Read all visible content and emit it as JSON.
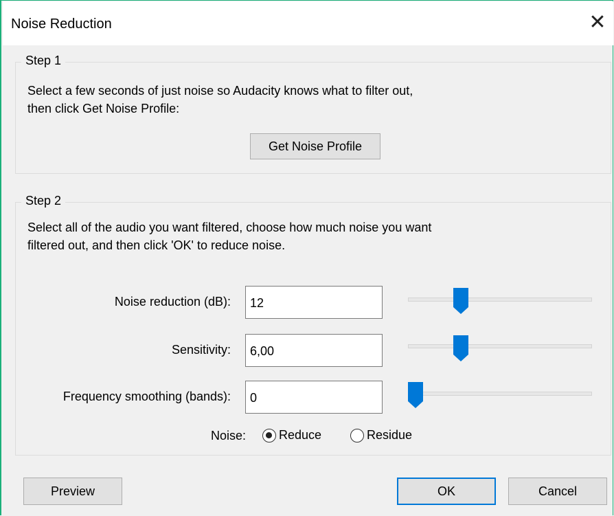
{
  "window": {
    "title": "Noise Reduction",
    "close_glyph": "✕"
  },
  "step1": {
    "legend": "Step 1",
    "desc_line1": "Select a few seconds of just noise so Audacity knows what to filter out,",
    "desc_line2": "then click Get Noise Profile:",
    "button_label": "Get Noise Profile"
  },
  "step2": {
    "legend": "Step 2",
    "desc_line1": "Select all of the audio you want filtered, choose how much noise you want",
    "desc_line2": "filtered out, and then click 'OK' to reduce noise.",
    "noise_reduction": {
      "label": "Noise reduction (dB):",
      "value": "12",
      "slider_fraction": 0.27
    },
    "sensitivity": {
      "label": "Sensitivity:",
      "value": "6,00",
      "slider_fraction": 0.27
    },
    "freq_smoothing": {
      "label": "Frequency smoothing (bands):",
      "value": "0",
      "slider_fraction": 0.0
    },
    "noise_mode": {
      "label": "Noise:",
      "options": [
        {
          "label": "Reduce",
          "checked": true
        },
        {
          "label": "Residue",
          "checked": false
        }
      ]
    }
  },
  "footer": {
    "preview_label": "Preview",
    "ok_label": "OK",
    "cancel_label": "Cancel"
  },
  "colors": {
    "accent": "#0078d7",
    "window_border": "#1bb07a",
    "background": "#f0f0f0"
  }
}
